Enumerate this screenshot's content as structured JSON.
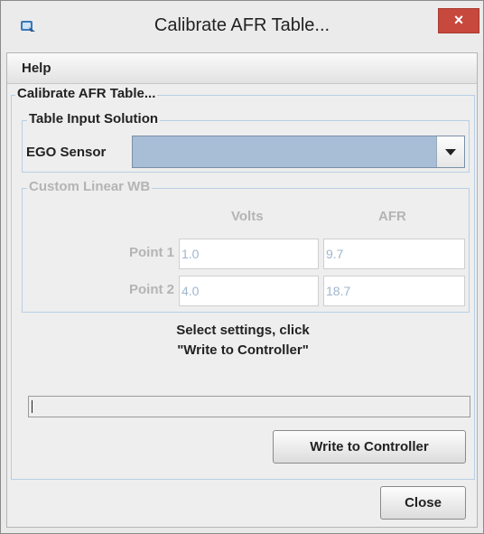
{
  "window": {
    "title": "Calibrate AFR Table...",
    "close_glyph": "×",
    "app_icon": "java-app-icon"
  },
  "menu": {
    "items": [
      {
        "label": "Help"
      }
    ]
  },
  "panel": {
    "title": "Calibrate AFR Table...",
    "input_solution": {
      "legend": "Table Input Solution",
      "ego_label": "EGO Sensor",
      "ego_value": ""
    },
    "custom_wb": {
      "legend": "Custom Linear WB",
      "columns": [
        "Volts",
        "AFR"
      ],
      "rows": [
        {
          "label": "Point 1",
          "volts": "1.0",
          "afr": "9.7"
        },
        {
          "label": "Point 2",
          "volts": "4.0",
          "afr": "18.7"
        }
      ]
    },
    "message_line1": "Select settings, click",
    "message_line2": "\"Write to Controller\"",
    "progress_text": "",
    "write_button": "Write to Controller",
    "close_button": "Close"
  },
  "colors": {
    "accent_blue": "#a7bed6",
    "close_red": "#c7483c",
    "disabled_text": "#b4b4b4",
    "field_text": "#9fb6cf"
  }
}
